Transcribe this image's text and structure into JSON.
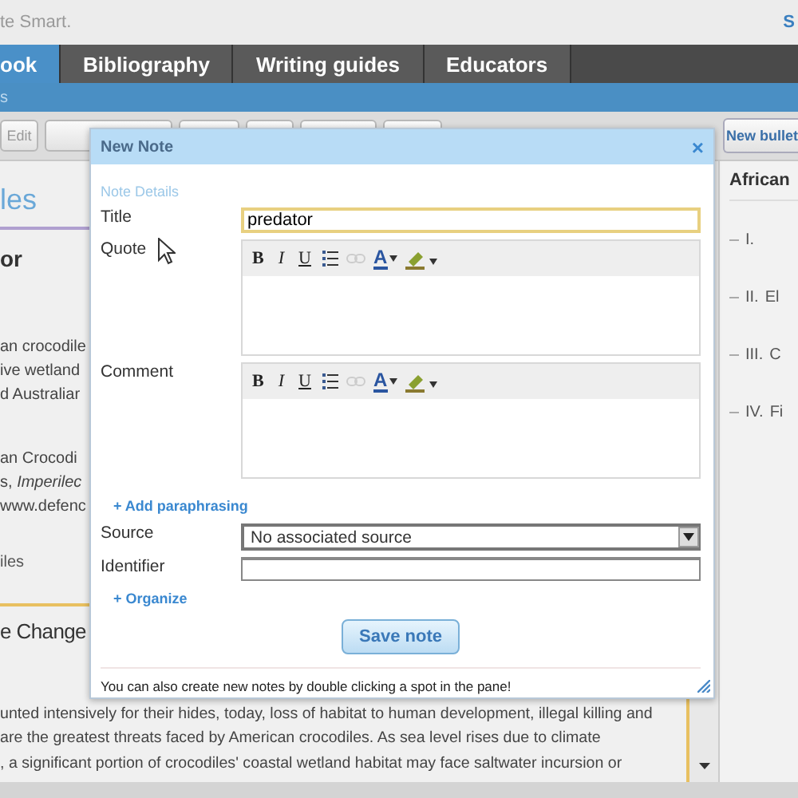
{
  "header": {
    "brand": "te Smart.",
    "corner_link": "S"
  },
  "nav_tabs": [
    {
      "label": "ook",
      "selected": true
    },
    {
      "label": "Bibliography",
      "selected": false
    },
    {
      "label": "Writing guides",
      "selected": false
    },
    {
      "label": "Educators",
      "selected": false
    }
  ],
  "sub_nav": {
    "label": "s"
  },
  "toolbar": {
    "edit_button": "Edit",
    "right_button": "New bullet"
  },
  "left_pane": {
    "heading": "les",
    "subheading": "or",
    "summary_lines": [
      "an crocodile",
      "ive wetland",
      "d Australiar"
    ],
    "citation_lines": [
      "an Crocodi",
      "s, *Imperilec*",
      "www.defenc"
    ],
    "tag": "iles",
    "section_heading": "e Change",
    "paragraph_lines": [
      "unted intensively for their hides, today, loss of habitat to human development, illegal killing and",
      "are the greatest threats faced by American crocodiles. As sea level rises due to climate",
      ", a significant portion of crocodiles' coastal wetland habitat may face saltwater incursion or"
    ]
  },
  "outline": {
    "title": "African",
    "items": [
      {
        "numeral": "I."
      },
      {
        "numeral": "II.",
        "text": "El"
      },
      {
        "numeral": "III.",
        "text": "C"
      },
      {
        "numeral": "IV.",
        "text": "Fi"
      }
    ]
  },
  "modal": {
    "title": "New Note",
    "close": "×",
    "section": "Note Details",
    "title_label": "Title",
    "title_value": "predator",
    "editors": [
      {
        "label": "Quote",
        "toolbar": [
          {
            "kind": "bold",
            "label": "B",
            "disabled": false
          },
          {
            "kind": "italic",
            "label": "I",
            "disabled": false
          },
          {
            "kind": "underline",
            "label": "U",
            "disabled": false
          },
          {
            "kind": "list",
            "disabled": false
          },
          {
            "kind": "link",
            "disabled": true
          },
          {
            "kind": "font_color",
            "label": "A",
            "disabled": false
          },
          {
            "kind": "highlight",
            "disabled": false
          }
        ]
      },
      {
        "label": "Comment",
        "toolbar": [
          {
            "kind": "bold",
            "label": "B",
            "disabled": false
          },
          {
            "kind": "italic",
            "label": "I",
            "disabled": false
          },
          {
            "kind": "underline",
            "label": "U",
            "disabled": false
          },
          {
            "kind": "list",
            "disabled": false
          },
          {
            "kind": "link",
            "disabled": true
          },
          {
            "kind": "font_color",
            "label": "A",
            "disabled": false
          },
          {
            "kind": "highlight",
            "disabled": false
          }
        ]
      }
    ],
    "add_paraphrasing": "+ Add paraphrasing",
    "source_label": "Source",
    "source_value": "No associated source",
    "identifier_label": "Identifier",
    "organize": "+ Organize",
    "save_button": "Save note",
    "hint": "You can also create new notes by double clicking a spot in the pane!"
  }
}
